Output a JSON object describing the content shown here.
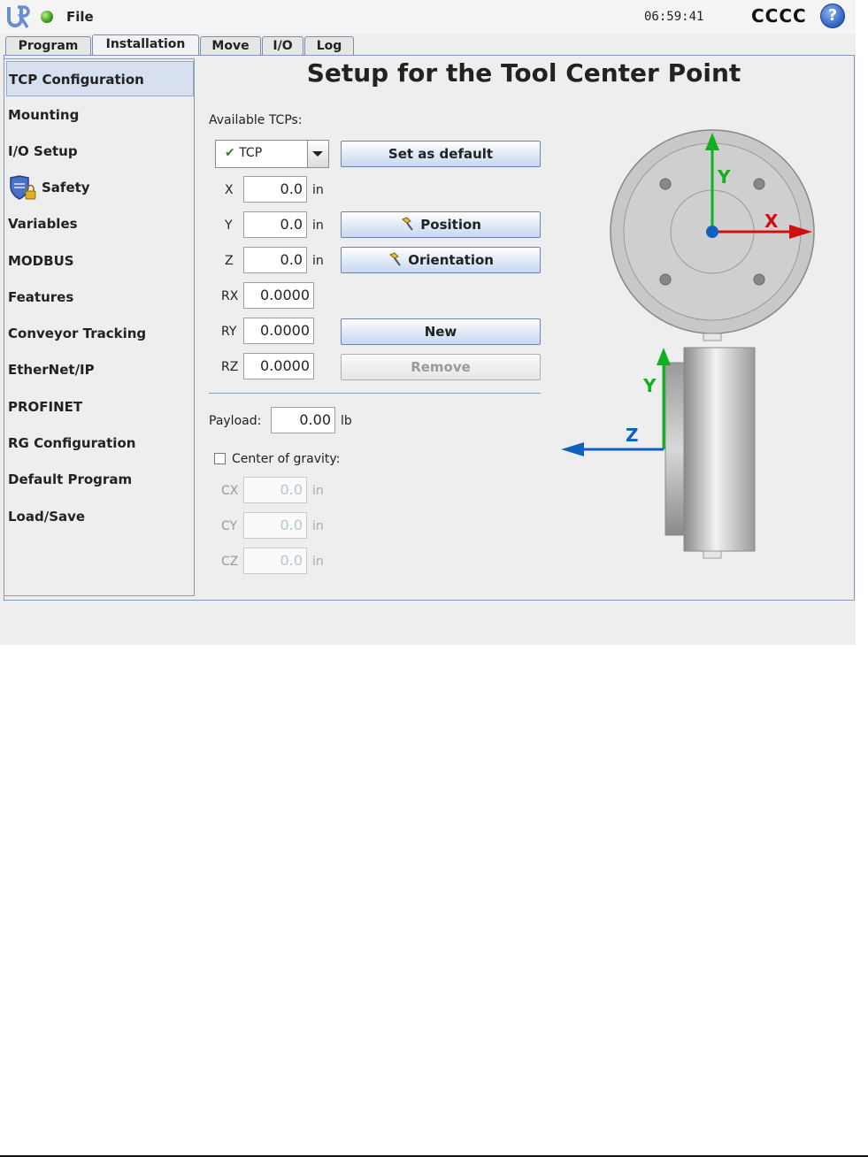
{
  "topbar": {
    "file_label": "File",
    "time": "06:59:41",
    "robot_name": "CCCC",
    "help_label": "?"
  },
  "tabs": [
    {
      "label": "Program",
      "active": false
    },
    {
      "label": "Installation",
      "active": true
    },
    {
      "label": "Move",
      "active": false
    },
    {
      "label": "I/O",
      "active": false
    },
    {
      "label": "Log",
      "active": false
    }
  ],
  "sidebar": {
    "items": [
      {
        "label": "TCP Configuration",
        "active": true
      },
      {
        "label": "Mounting"
      },
      {
        "label": "I/O Setup"
      },
      {
        "label": "Safety",
        "icon": "shield-lock-icon"
      },
      {
        "label": "Variables"
      },
      {
        "label": "MODBUS"
      },
      {
        "label": "Features"
      },
      {
        "label": "Conveyor Tracking"
      },
      {
        "label": "EtherNet/IP"
      },
      {
        "label": "PROFINET"
      },
      {
        "label": "RG Configuration"
      },
      {
        "label": "Default Program"
      },
      {
        "label": "Load/Save"
      }
    ]
  },
  "main": {
    "title": "Setup for the Tool Center Point",
    "available_label": "Available TCPs:",
    "tcp_selected": "TCP",
    "set_default_label": "Set as default",
    "position_label": "Position",
    "orientation_label": "Orientation",
    "new_label": "New",
    "remove_label": "Remove",
    "fields": {
      "x": {
        "label": "X",
        "value": "0.0",
        "unit": "in"
      },
      "y": {
        "label": "Y",
        "value": "0.0",
        "unit": "in"
      },
      "z": {
        "label": "Z",
        "value": "0.0",
        "unit": "in"
      },
      "rx": {
        "label": "RX",
        "value": "0.0000"
      },
      "ry": {
        "label": "RY",
        "value": "0.0000"
      },
      "rz": {
        "label": "RZ",
        "value": "0.0000"
      }
    },
    "payload": {
      "label": "Payload:",
      "value": "0.00",
      "unit": "lb"
    },
    "cog": {
      "label": "Center of gravity:",
      "checked": false,
      "cx": {
        "label": "CX",
        "value": "0.0",
        "unit": "in"
      },
      "cy": {
        "label": "CY",
        "value": "0.0",
        "unit": "in"
      },
      "cz": {
        "label": "CZ",
        "value": "0.0",
        "unit": "in"
      }
    },
    "diagram": {
      "axis_x": "X",
      "axis_y_top": "Y",
      "axis_y_side": "Y",
      "axis_z": "Z",
      "colors": {
        "x": "#d01010",
        "y": "#10b020",
        "z": "#1060c0"
      }
    }
  },
  "colors": {
    "accent": "#2f5fc0",
    "status_ok": "#3a9a1a"
  }
}
